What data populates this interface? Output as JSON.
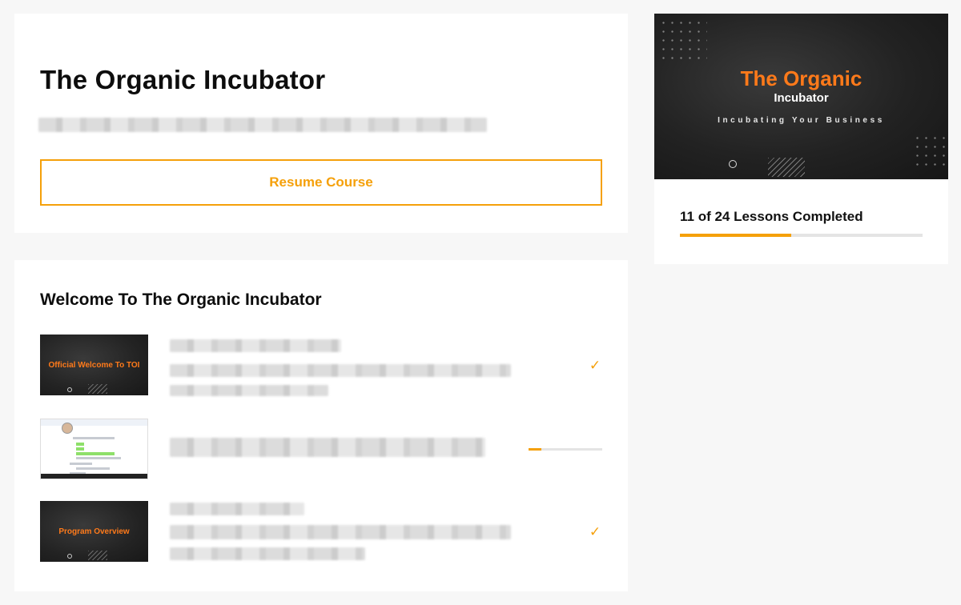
{
  "header": {
    "course_title": "The Organic Incubator",
    "resume_label": "Resume Course"
  },
  "sidebar": {
    "banner_title": "The Organic",
    "banner_subtitle": "Incubator",
    "banner_tagline": "Incubating Your Business",
    "progress_label": "11 of 24 Lessons Completed",
    "progress_fraction": 0.4583,
    "accent_color": "#f5a00a"
  },
  "lessons_section": {
    "title": "Welcome To The Organic Incubator",
    "lessons": [
      {
        "thumb_text": "Official Welcome To TOI",
        "status": "completed",
        "status_icon": "checkmark-icon"
      },
      {
        "thumb_text": "",
        "status": "in-progress",
        "progress_fraction": 0.17
      },
      {
        "thumb_text": "Program Overview",
        "status": "completed",
        "status_icon": "checkmark-icon"
      }
    ]
  }
}
